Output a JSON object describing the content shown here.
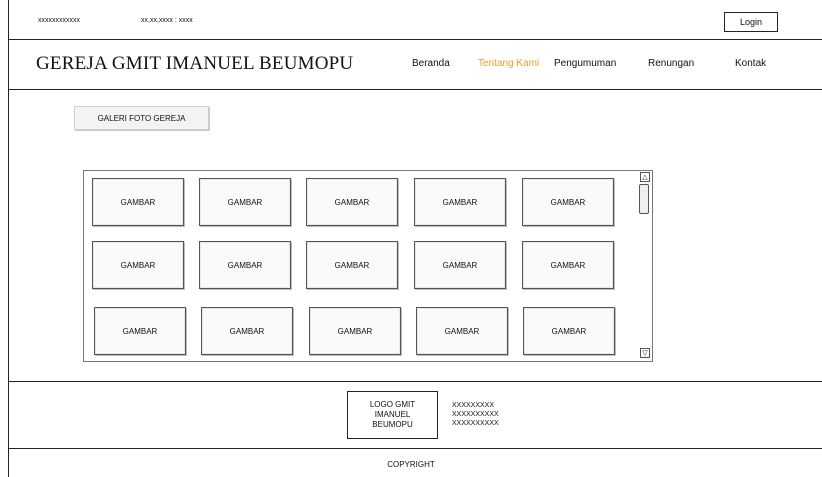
{
  "topbar": {
    "left_text": "xxxxxxxxxxxx",
    "datetime_text": "xx,xx,xxxx : xxxx",
    "login_label": "Login"
  },
  "brand": {
    "title": "GEREJA GMIT IMANUEL BEUMOPU"
  },
  "nav": {
    "items": [
      {
        "label": "Beranda"
      },
      {
        "label": "Tentang Kami",
        "active": true
      },
      {
        "label": "Pengumuman"
      },
      {
        "label": "Renungan"
      },
      {
        "label": "Kontak"
      }
    ],
    "active_color": "#f39a1f"
  },
  "gallery": {
    "button_label": "GALERI FOTO GEREJA",
    "thumbnails": [
      "GAMBAR",
      "GAMBAR",
      "GAMBAR",
      "GAMBAR",
      "GAMBAR",
      "GAMBAR",
      "GAMBAR",
      "GAMBAR",
      "GAMBAR",
      "GAMBAR",
      "GAMBAR",
      "GAMBAR",
      "GAMBAR",
      "GAMBAR",
      "GAMBAR"
    ]
  },
  "footer": {
    "logo_lines": [
      "LOGO GMIT",
      "IMANUEL",
      "BEUMOPU"
    ],
    "info_lines": [
      "XXXXXXXXX",
      "XXXXXXXXXX",
      "XXXXXXXXXX"
    ],
    "copyright": "COPYRIGHT"
  }
}
